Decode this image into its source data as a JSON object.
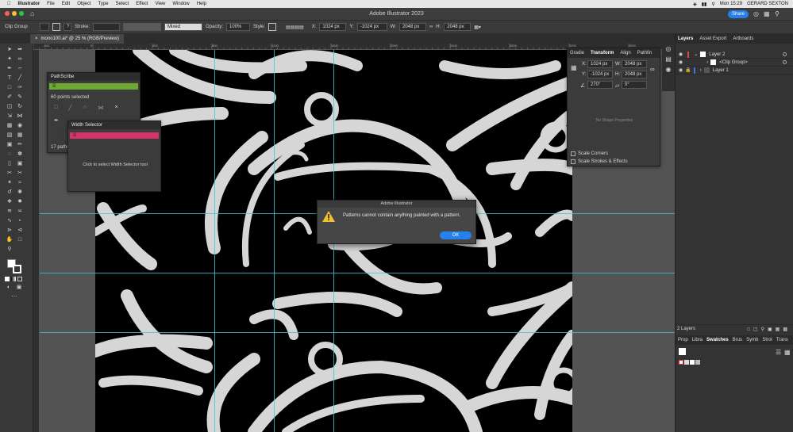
{
  "menubar": {
    "app": "Illustrator",
    "items": [
      "File",
      "Edit",
      "Object",
      "Type",
      "Select",
      "Effect",
      "View",
      "Window",
      "Help"
    ],
    "clock": "Mon 15:29",
    "user": "GERARD SEXTON"
  },
  "app": {
    "title": "Adobe Illustrator 2023",
    "share": "Share"
  },
  "control": {
    "selection": "Clip Group",
    "stroke_label": "Stroke:",
    "mixed": "Mixed",
    "opacity_label": "Opacity:",
    "opacity": "100%",
    "style_label": "Style:",
    "x_label": "X:",
    "x": "1024 px",
    "y_label": "Y:",
    "y": "-1024 px",
    "w_label": "W:",
    "w": "2048 px",
    "h_label": "H:",
    "h": "2048 px"
  },
  "document": {
    "tab": "mono100.ai* @ 25 % (RGB/Preview)"
  },
  "ruler": [
    "-400",
    "0",
    "400",
    "800",
    "1200",
    "1600",
    "2000",
    "2400",
    "2800",
    "3200",
    "3600",
    "4000"
  ],
  "pathscribe": {
    "title": "PathScribe",
    "points": "60 points selected",
    "paths": "17 paths"
  },
  "width_selector": {
    "title": "Width Selector",
    "hint": "Click to select Width Selector tool"
  },
  "dialog": {
    "title": "Adobe Illustrator",
    "message": "Patterns cannot contain anything painted with a pattern.",
    "ok": "OK"
  },
  "transform": {
    "tabs": [
      "Gradie",
      "Transform",
      "Align",
      "Pathfin"
    ],
    "x_label": "X:",
    "x": "1024 px",
    "y_label": "Y:",
    "y": "-1024 px",
    "w_label": "W:",
    "w": "2048 px",
    "h_label": "H:",
    "h": "2048 px",
    "angle": "270°",
    "shear": "0°",
    "no_shape": "No Shape Properties",
    "scale_corners": "Scale Corners",
    "scale_strokes": "Scale Strokes & Effects"
  },
  "layers": {
    "tabs": [
      "Layers",
      "Asset Export",
      "Artboards"
    ],
    "rows": [
      "Layer 2",
      "<Clip Group>",
      "Layer 1"
    ],
    "count": "2 Layers",
    "layer2_color": "#e04848",
    "layer1_color": "#4a6ee0"
  },
  "swatches": {
    "tabs": [
      "Prop",
      "Libra",
      "Swatches",
      "Brus",
      "Symb",
      "Strol",
      "Trans"
    ]
  },
  "colors": {
    "accent": "#2680eb",
    "pathscribe_bar": "#6fa832",
    "width_bar": "#d6336c",
    "guide": "#3fc5d3"
  }
}
